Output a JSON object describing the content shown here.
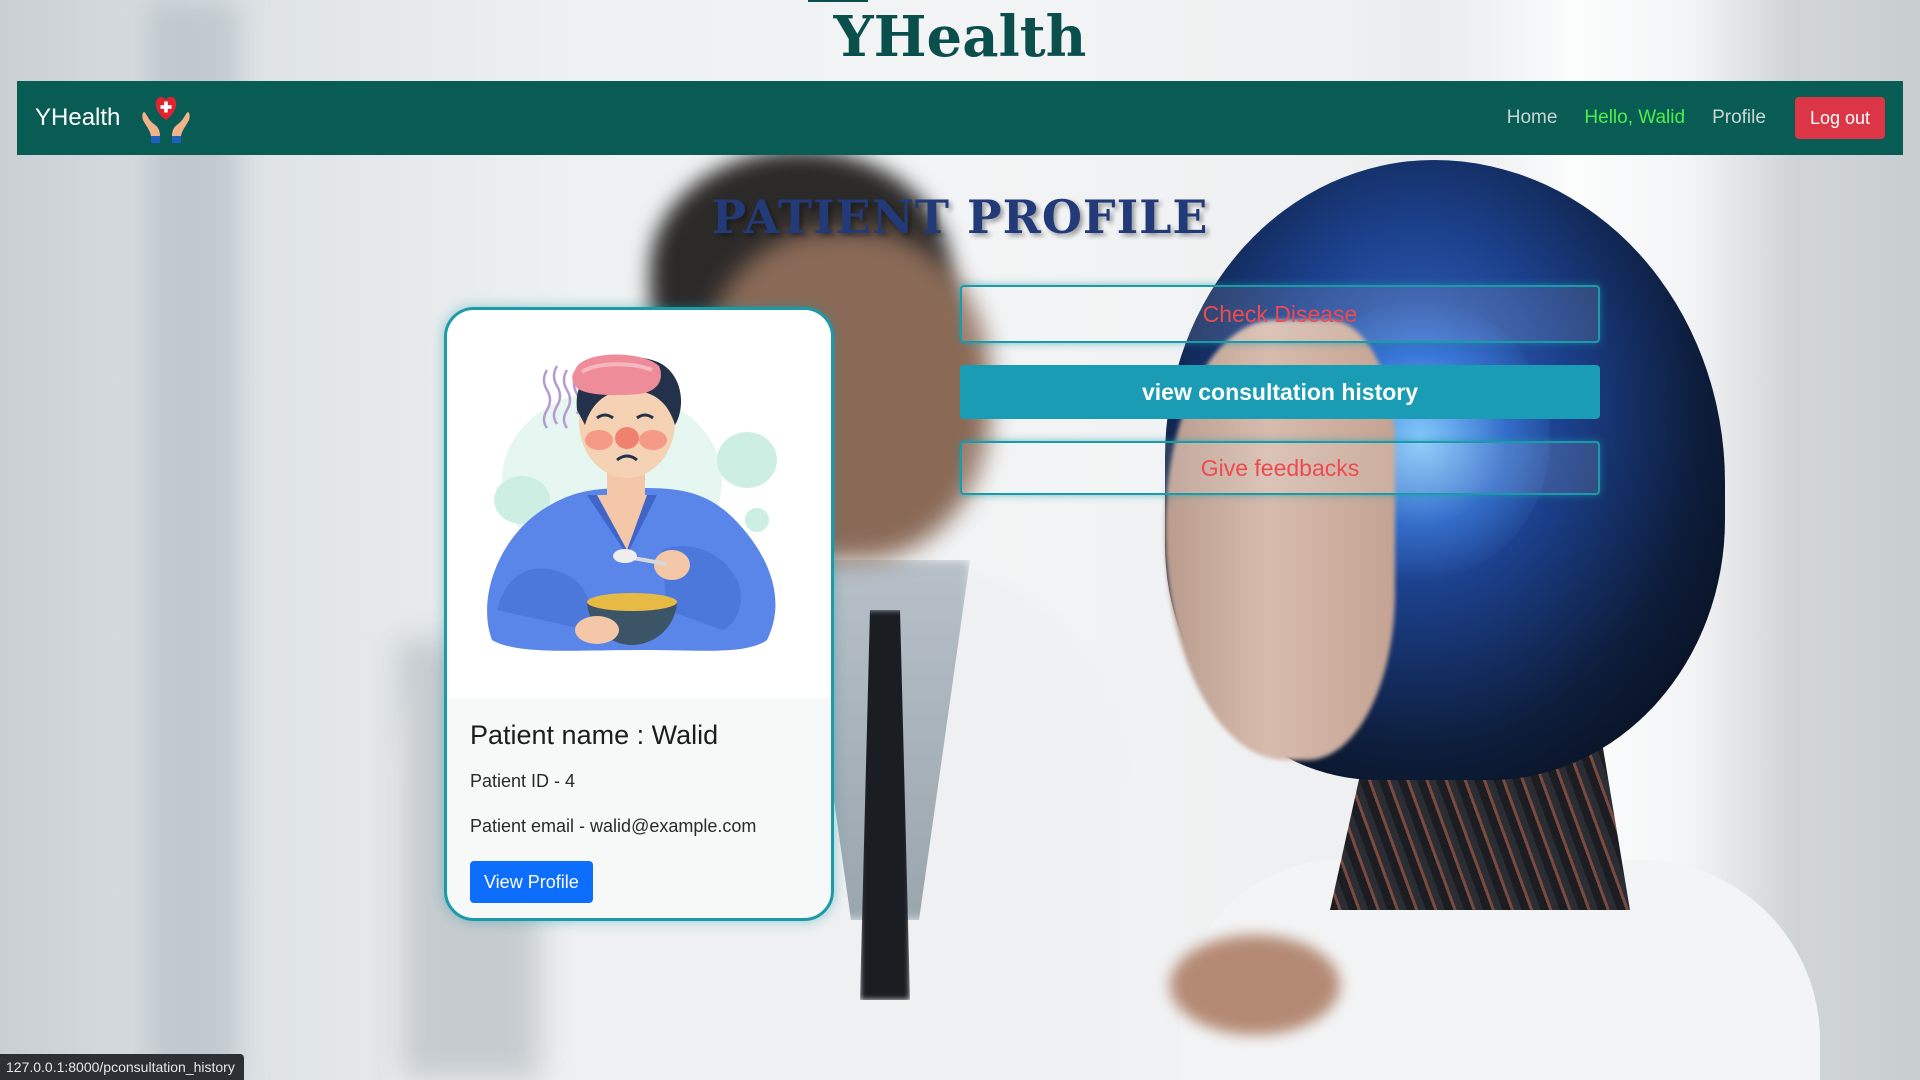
{
  "site": {
    "title": "YHealth"
  },
  "navbar": {
    "brand": "YHealth",
    "logo_icon": "hands-heart-icon",
    "links": {
      "home": "Home",
      "greeting": "Hello, Walid",
      "profile": "Profile"
    },
    "logout_label": "Log out"
  },
  "page": {
    "heading": "PATIENT PROFILE"
  },
  "patient_card": {
    "illustration": "sick-patient-illustration",
    "name_line": "Patient name : Walid",
    "id_line": "Patient ID - 4",
    "email_line": "Patient email - walid@example.com",
    "button_label": "View Profile"
  },
  "actions": {
    "check_disease": "Check Disease",
    "consultation_history": "view consultation history",
    "feedback": "Give feedbacks"
  },
  "status_bar": {
    "url": "127.0.0.1:8000/pconsultation_history"
  },
  "colors": {
    "navbar": "#085c54",
    "title": "#0a4f4c",
    "heading": "#233a78",
    "greeting": "#4cf04c",
    "logout": "#dc3545",
    "accent": "#1a9cb5",
    "outline_text": "#ef4a50",
    "view_button": "#0d6efd"
  }
}
